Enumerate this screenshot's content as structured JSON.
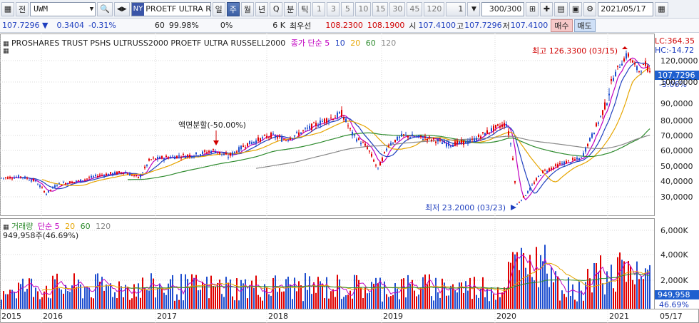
{
  "toolbar": {
    "icon_box_label": "전",
    "code": "UWM",
    "exchange_tag": "NY",
    "name": "PROETF ULTRA RUSS",
    "period_tabs": [
      "일",
      "주",
      "월",
      "년"
    ],
    "active_period": "주",
    "q_label": "Q",
    "minute_label": "분",
    "tick_label": "틱",
    "numbers": [
      "1",
      "3",
      "5",
      "10",
      "15",
      "30",
      "45",
      "120"
    ],
    "unit_value": "1",
    "count": "300/300",
    "date": "2021/05/17"
  },
  "quote": {
    "price": "107.7296",
    "change": "0.3404",
    "change_pct": "-0.31%",
    "v1": "60",
    "v2": "99.98%",
    "v3": "0%",
    "v4": "6 K",
    "best_label": "최우선",
    "best_ask": "108.2300",
    "best_bid": "108.1900",
    "open_label": "시",
    "open": "107.4100",
    "high_label": "고",
    "high": "107.7296",
    "low_label": "저",
    "low": "107.4100",
    "buy_label": "매수",
    "sell_label": "매도"
  },
  "price_pane": {
    "title": "PROSHARES TRUST PSHS ULTRUSS2000  PROETF ULTRA RUSSELL2000",
    "ma_label": "종가 단순",
    "ma_periods": [
      "5",
      "10",
      "20",
      "60",
      "120"
    ],
    "ma_colors": [
      "#c000c0",
      "#1f3fbf",
      "#e6a500",
      "#2e8b2e",
      "#888888"
    ],
    "lc_text": "LC:364.35",
    "hc_text": "HC:-14.72",
    "y_ticks": [
      "120,0000",
      "100,0000",
      "90,0000",
      "80,0000",
      "70,0000",
      "60,0000",
      "50,0000",
      "40,0000",
      "30,0000"
    ],
    "current_price_tag": "107.7296",
    "current_pct_tag": "-3.06%",
    "max_annotation": "최고 126.3300 (03/15)",
    "min_annotation": "최저 23.2000 (03/23)",
    "split_annotation": "액면분할(-50.00%)"
  },
  "volume_pane": {
    "label": "거래량",
    "ma_label": "단순",
    "ma_periods": [
      "5",
      "20",
      "60",
      "120"
    ],
    "value_text": "949,958주(46.69%)",
    "y_ticks": [
      "6,000K",
      "4,000K",
      "2,000K"
    ],
    "current_volume_tag": "949,958",
    "current_pct_tag": "46.69%"
  },
  "x_axis": {
    "labels": [
      "2015",
      "2016",
      "2017",
      "2018",
      "2019",
      "2020",
      "2021",
      "05/17"
    ]
  },
  "colors": {
    "up": "#e00000",
    "down": "#1f4fcf",
    "grid": "#d8d8d8",
    "tag_bg": "#1f5fcf"
  }
}
